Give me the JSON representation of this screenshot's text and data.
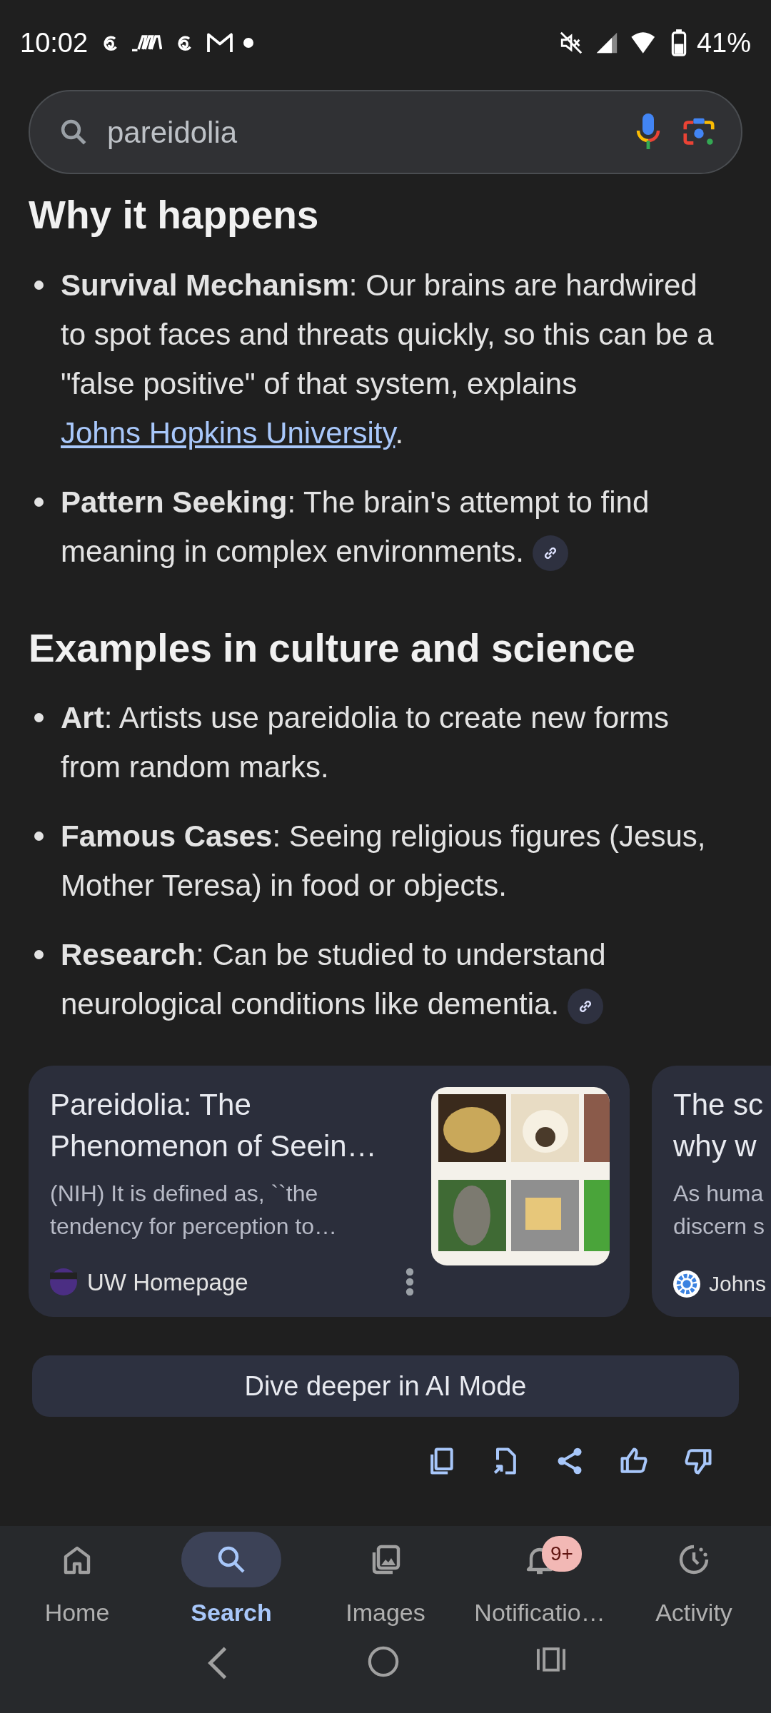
{
  "status_bar": {
    "time": "10:02",
    "battery": "41%"
  },
  "search": {
    "value": "pareidolia"
  },
  "sections": [
    {
      "heading": "Why it happens",
      "bullets": [
        {
          "text": "**Survival Mechanism**: Our brains are hardwired to spot faces and threats quickly, so this can be a \"false positive\" of that system, explains ",
          "link": "Johns Hopkins University",
          "after": ".",
          "citation": false
        },
        {
          "text": "**Pattern Seeking**: The brain's attempt to find meaning in complex environments.",
          "citation": true
        }
      ]
    },
    {
      "heading": "Examples in culture and science",
      "bullets": [
        {
          "text": "**Art**: Artists use pareidolia to create new forms from random marks.",
          "citation": false
        },
        {
          "text": "**Famous Cases**: Seeing religious figures (Jesus, Mother Teresa) in food or objects.",
          "citation": false
        },
        {
          "text": "**Research**: Can be studied to understand neurological conditions like dementia.",
          "citation": true
        }
      ]
    }
  ],
  "cards": [
    {
      "title_lines": [
        "Pareidolia: The",
        "Phenomenon of Seein…"
      ],
      "snippet_lines": [
        "(NIH) It is defined as, ``the",
        "tendency for perception to…"
      ],
      "source": "UW Homepage",
      "has_image": true,
      "has_menu": true
    },
    {
      "title_lines": [
        "The sc",
        "why w"
      ],
      "snippet_lines": [
        "As huma",
        "discern s"
      ],
      "source": "Johns",
      "has_image": false,
      "has_menu": false
    }
  ],
  "dive_button": "Dive deeper in AI Mode",
  "bottom_nav": [
    {
      "label": "Home",
      "selected": false
    },
    {
      "label": "Search",
      "selected": true
    },
    {
      "label": "Images",
      "selected": false
    },
    {
      "label": "Notificatio…",
      "selected": false,
      "badge": "9+"
    },
    {
      "label": "Activity",
      "selected": false
    }
  ]
}
